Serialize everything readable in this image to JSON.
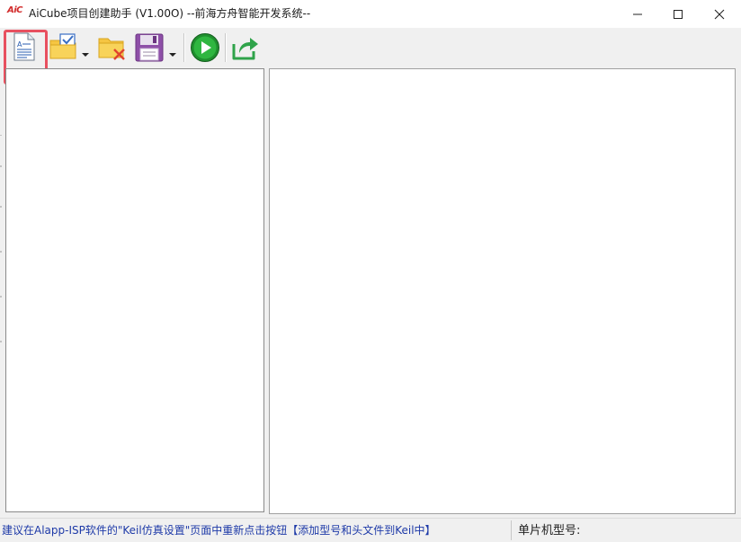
{
  "window": {
    "logo_text": "AiC",
    "title": "AiCube项目创建助手 (V1.00O) --前海方舟智能开发系统--",
    "controls": [
      "minimize",
      "maximize",
      "close"
    ]
  },
  "toolbar": {
    "buttons": [
      {
        "icon": "new-document-icon"
      },
      {
        "icon": "open-folder-icon",
        "has_dropdown": true
      },
      {
        "icon": "delete-folder-icon"
      },
      {
        "icon": "save-disk-icon",
        "has_dropdown": true
      },
      {
        "icon": "run-play-icon"
      },
      {
        "icon": "export-share-icon"
      }
    ]
  },
  "status": {
    "message": "建议在Alapp-ISP软件的\"Keil仿真设置\"页面中重新点击按钮【添加型号和头文件到Keil中】",
    "chip_label": "单片机型号:"
  },
  "colors": {
    "highlight": "#e8505f",
    "status_text": "#1e3aa8",
    "logo": "#d22a2a"
  }
}
